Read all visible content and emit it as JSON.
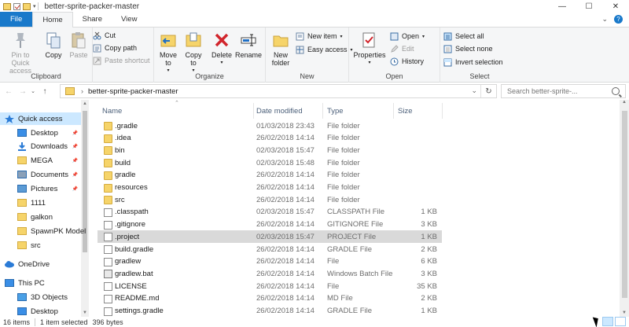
{
  "window": {
    "title": "better-sprite-packer-master",
    "controls": [
      "—",
      "☐",
      "✕"
    ]
  },
  "tabs": [
    "File",
    "Home",
    "Share",
    "View"
  ],
  "ribbon": {
    "clipboard": {
      "label": "Clipboard",
      "pin": "Pin to Quick access",
      "copy": "Copy",
      "paste": "Paste",
      "cut": "Cut",
      "copy_path": "Copy path",
      "paste_shortcut": "Paste shortcut"
    },
    "organize": {
      "label": "Organize",
      "move_to": "Move to",
      "copy_to": "Copy to",
      "delete": "Delete",
      "rename": "Rename"
    },
    "new": {
      "label": "New",
      "new_folder": "New folder",
      "new_item": "New item",
      "easy_access": "Easy access"
    },
    "open": {
      "label": "Open",
      "properties": "Properties",
      "open": "Open",
      "edit": "Edit",
      "history": "History"
    },
    "select": {
      "label": "Select",
      "select_all": "Select all",
      "select_none": "Select none",
      "invert": "Invert selection"
    }
  },
  "address": {
    "path": "better-sprite-packer-master",
    "search_placeholder": "Search better-sprite-..."
  },
  "nav": [
    {
      "label": "Quick access",
      "icon": "star-icon",
      "pin": false,
      "selected": true
    },
    {
      "label": "Desktop",
      "icon": "desktop-icon",
      "pin": true
    },
    {
      "label": "Downloads",
      "icon": "download-icon",
      "pin": true
    },
    {
      "label": "MEGA",
      "icon": "folder-icon",
      "pin": true
    },
    {
      "label": "Documents",
      "icon": "documents-icon",
      "pin": true
    },
    {
      "label": "Pictures",
      "icon": "pictures-icon",
      "pin": true
    },
    {
      "label": "1111",
      "icon": "folder-icon",
      "pin": false
    },
    {
      "label": "galkon",
      "icon": "folder-icon",
      "pin": false
    },
    {
      "label": "SpawnPK Model",
      "icon": "folder-icon",
      "pin": false
    },
    {
      "label": "src",
      "icon": "folder-icon",
      "pin": false
    },
    {
      "label": "OneDrive",
      "icon": "cloud-icon",
      "pin": false
    },
    {
      "label": "This PC",
      "icon": "computer-icon",
      "pin": false
    },
    {
      "label": "3D Objects",
      "icon": "cube-icon",
      "pin": false
    },
    {
      "label": "Desktop",
      "icon": "desktop-icon",
      "pin": false
    }
  ],
  "columns": {
    "name": "Name",
    "date": "Date modified",
    "type": "Type",
    "size": "Size"
  },
  "files": [
    {
      "name": ".gradle",
      "date": "01/03/2018 23:43",
      "type": "File folder",
      "size": "",
      "kind": "folder"
    },
    {
      "name": ".idea",
      "date": "26/02/2018 14:14",
      "type": "File folder",
      "size": "",
      "kind": "folder"
    },
    {
      "name": "bin",
      "date": "02/03/2018 15:47",
      "type": "File folder",
      "size": "",
      "kind": "folder"
    },
    {
      "name": "build",
      "date": "02/03/2018 15:48",
      "type": "File folder",
      "size": "",
      "kind": "folder"
    },
    {
      "name": "gradle",
      "date": "26/02/2018 14:14",
      "type": "File folder",
      "size": "",
      "kind": "folder"
    },
    {
      "name": "resources",
      "date": "26/02/2018 14:14",
      "type": "File folder",
      "size": "",
      "kind": "folder"
    },
    {
      "name": "src",
      "date": "26/02/2018 14:14",
      "type": "File folder",
      "size": "",
      "kind": "folder"
    },
    {
      "name": ".classpath",
      "date": "02/03/2018 15:47",
      "type": "CLASSPATH File",
      "size": "1 KB",
      "kind": "file"
    },
    {
      "name": ".gitignore",
      "date": "26/02/2018 14:14",
      "type": "GITIGNORE File",
      "size": "3 KB",
      "kind": "file"
    },
    {
      "name": ".project",
      "date": "02/03/2018 15:47",
      "type": "PROJECT File",
      "size": "1 KB",
      "kind": "file",
      "selected": true
    },
    {
      "name": "build.gradle",
      "date": "26/02/2018 14:14",
      "type": "GRADLE File",
      "size": "2 KB",
      "kind": "file"
    },
    {
      "name": "gradlew",
      "date": "26/02/2018 14:14",
      "type": "File",
      "size": "6 KB",
      "kind": "file"
    },
    {
      "name": "gradlew.bat",
      "date": "26/02/2018 14:14",
      "type": "Windows Batch File",
      "size": "3 KB",
      "kind": "bat"
    },
    {
      "name": "LICENSE",
      "date": "26/02/2018 14:14",
      "type": "File",
      "size": "35 KB",
      "kind": "file"
    },
    {
      "name": "README.md",
      "date": "26/02/2018 14:14",
      "type": "MD File",
      "size": "2 KB",
      "kind": "file"
    },
    {
      "name": "settings.gradle",
      "date": "26/02/2018 14:14",
      "type": "GRADLE File",
      "size": "1 KB",
      "kind": "file"
    }
  ],
  "status": {
    "items": "16 items",
    "selected": "1 item selected",
    "size": "396 bytes"
  },
  "colors": {
    "file_tab": "#1979ca",
    "selection": "#cce8ff",
    "row_selected": "#d9d9d9",
    "folder": "#f6d46a"
  }
}
